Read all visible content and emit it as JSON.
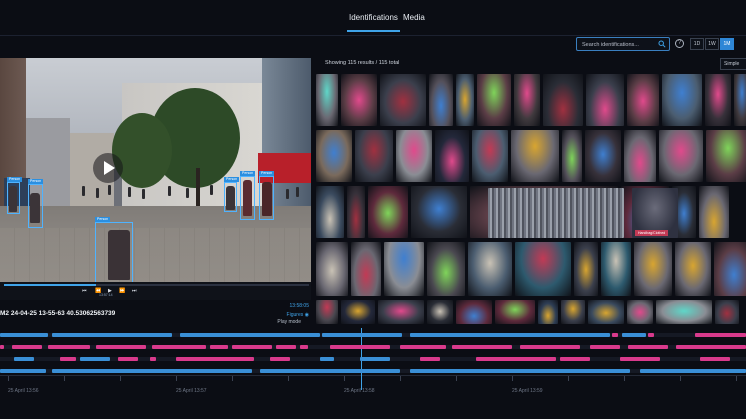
{
  "nav": {
    "tabs": [
      {
        "label": "Identifications",
        "active": true
      },
      {
        "label": "Media",
        "active": false
      }
    ]
  },
  "search": {
    "placeholder": "Search identifications..."
  },
  "help_icon_glyph": "?",
  "range_buttons": [
    {
      "label": "1D",
      "active": false
    },
    {
      "label": "1W",
      "active": false
    },
    {
      "label": "1M",
      "active": true
    }
  ],
  "results": {
    "summary": "Showing 115 results / 115 total",
    "view_mode": "Simple"
  },
  "video": {
    "detection_label": "Person",
    "timecode": "13:57:14",
    "progress": 0.3,
    "camera_id": "M2 24-04-25 13-55-63 40.53062563739",
    "current_time": "13:58:05",
    "figures_label": "Figures",
    "play_mode_label": "Play mode"
  },
  "thumbnail_tag": "Handbag/Clothed",
  "timeline": {
    "tick_labels": [
      "25 April 13:56",
      "25 April 13:57",
      "25 April 13:58",
      "25 April 13:59"
    ],
    "current_position": 0.484
  },
  "colors": {
    "accent": "#3fa3e8",
    "track_blue": "#3a8fd6",
    "track_pink": "#d93a8c",
    "tag_red": "#c23a55"
  },
  "icons": {
    "search": "search-icon",
    "help": "help-icon",
    "play": "play-icon"
  }
}
